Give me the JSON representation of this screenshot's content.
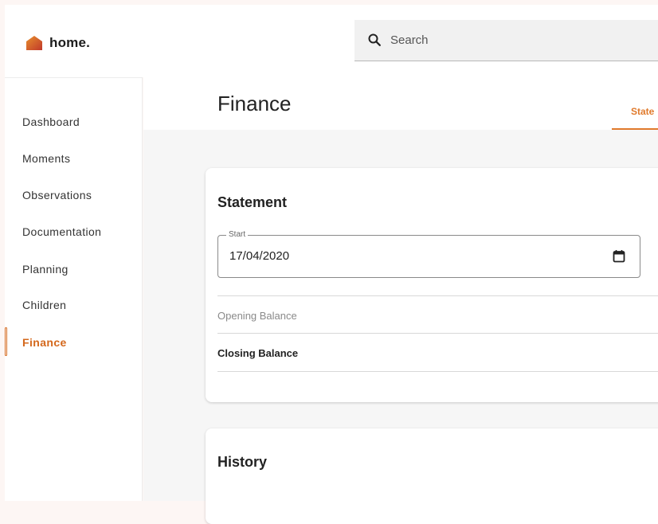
{
  "app": {
    "logo_text": "home.",
    "brand_color": "#d4681c"
  },
  "search": {
    "placeholder": "Search",
    "value": ""
  },
  "sidebar": {
    "items": [
      {
        "label": "Dashboard",
        "active": false
      },
      {
        "label": "Moments",
        "active": false
      },
      {
        "label": "Observations",
        "active": false
      },
      {
        "label": "Documentation",
        "active": false
      },
      {
        "label": "Planning",
        "active": false
      },
      {
        "label": "Children",
        "active": false
      },
      {
        "label": "Finance",
        "active": true
      }
    ]
  },
  "page": {
    "title": "Finance",
    "active_tab": "State"
  },
  "statement": {
    "title": "Statement",
    "start_label": "Start",
    "start_value": "17/04/2020",
    "opening_balance_label": "Opening Balance",
    "closing_balance_label": "Closing Balance"
  },
  "history": {
    "title": "History"
  },
  "icons": {
    "logo": "house-icon",
    "search": "search-icon",
    "calendar": "calendar-icon"
  }
}
